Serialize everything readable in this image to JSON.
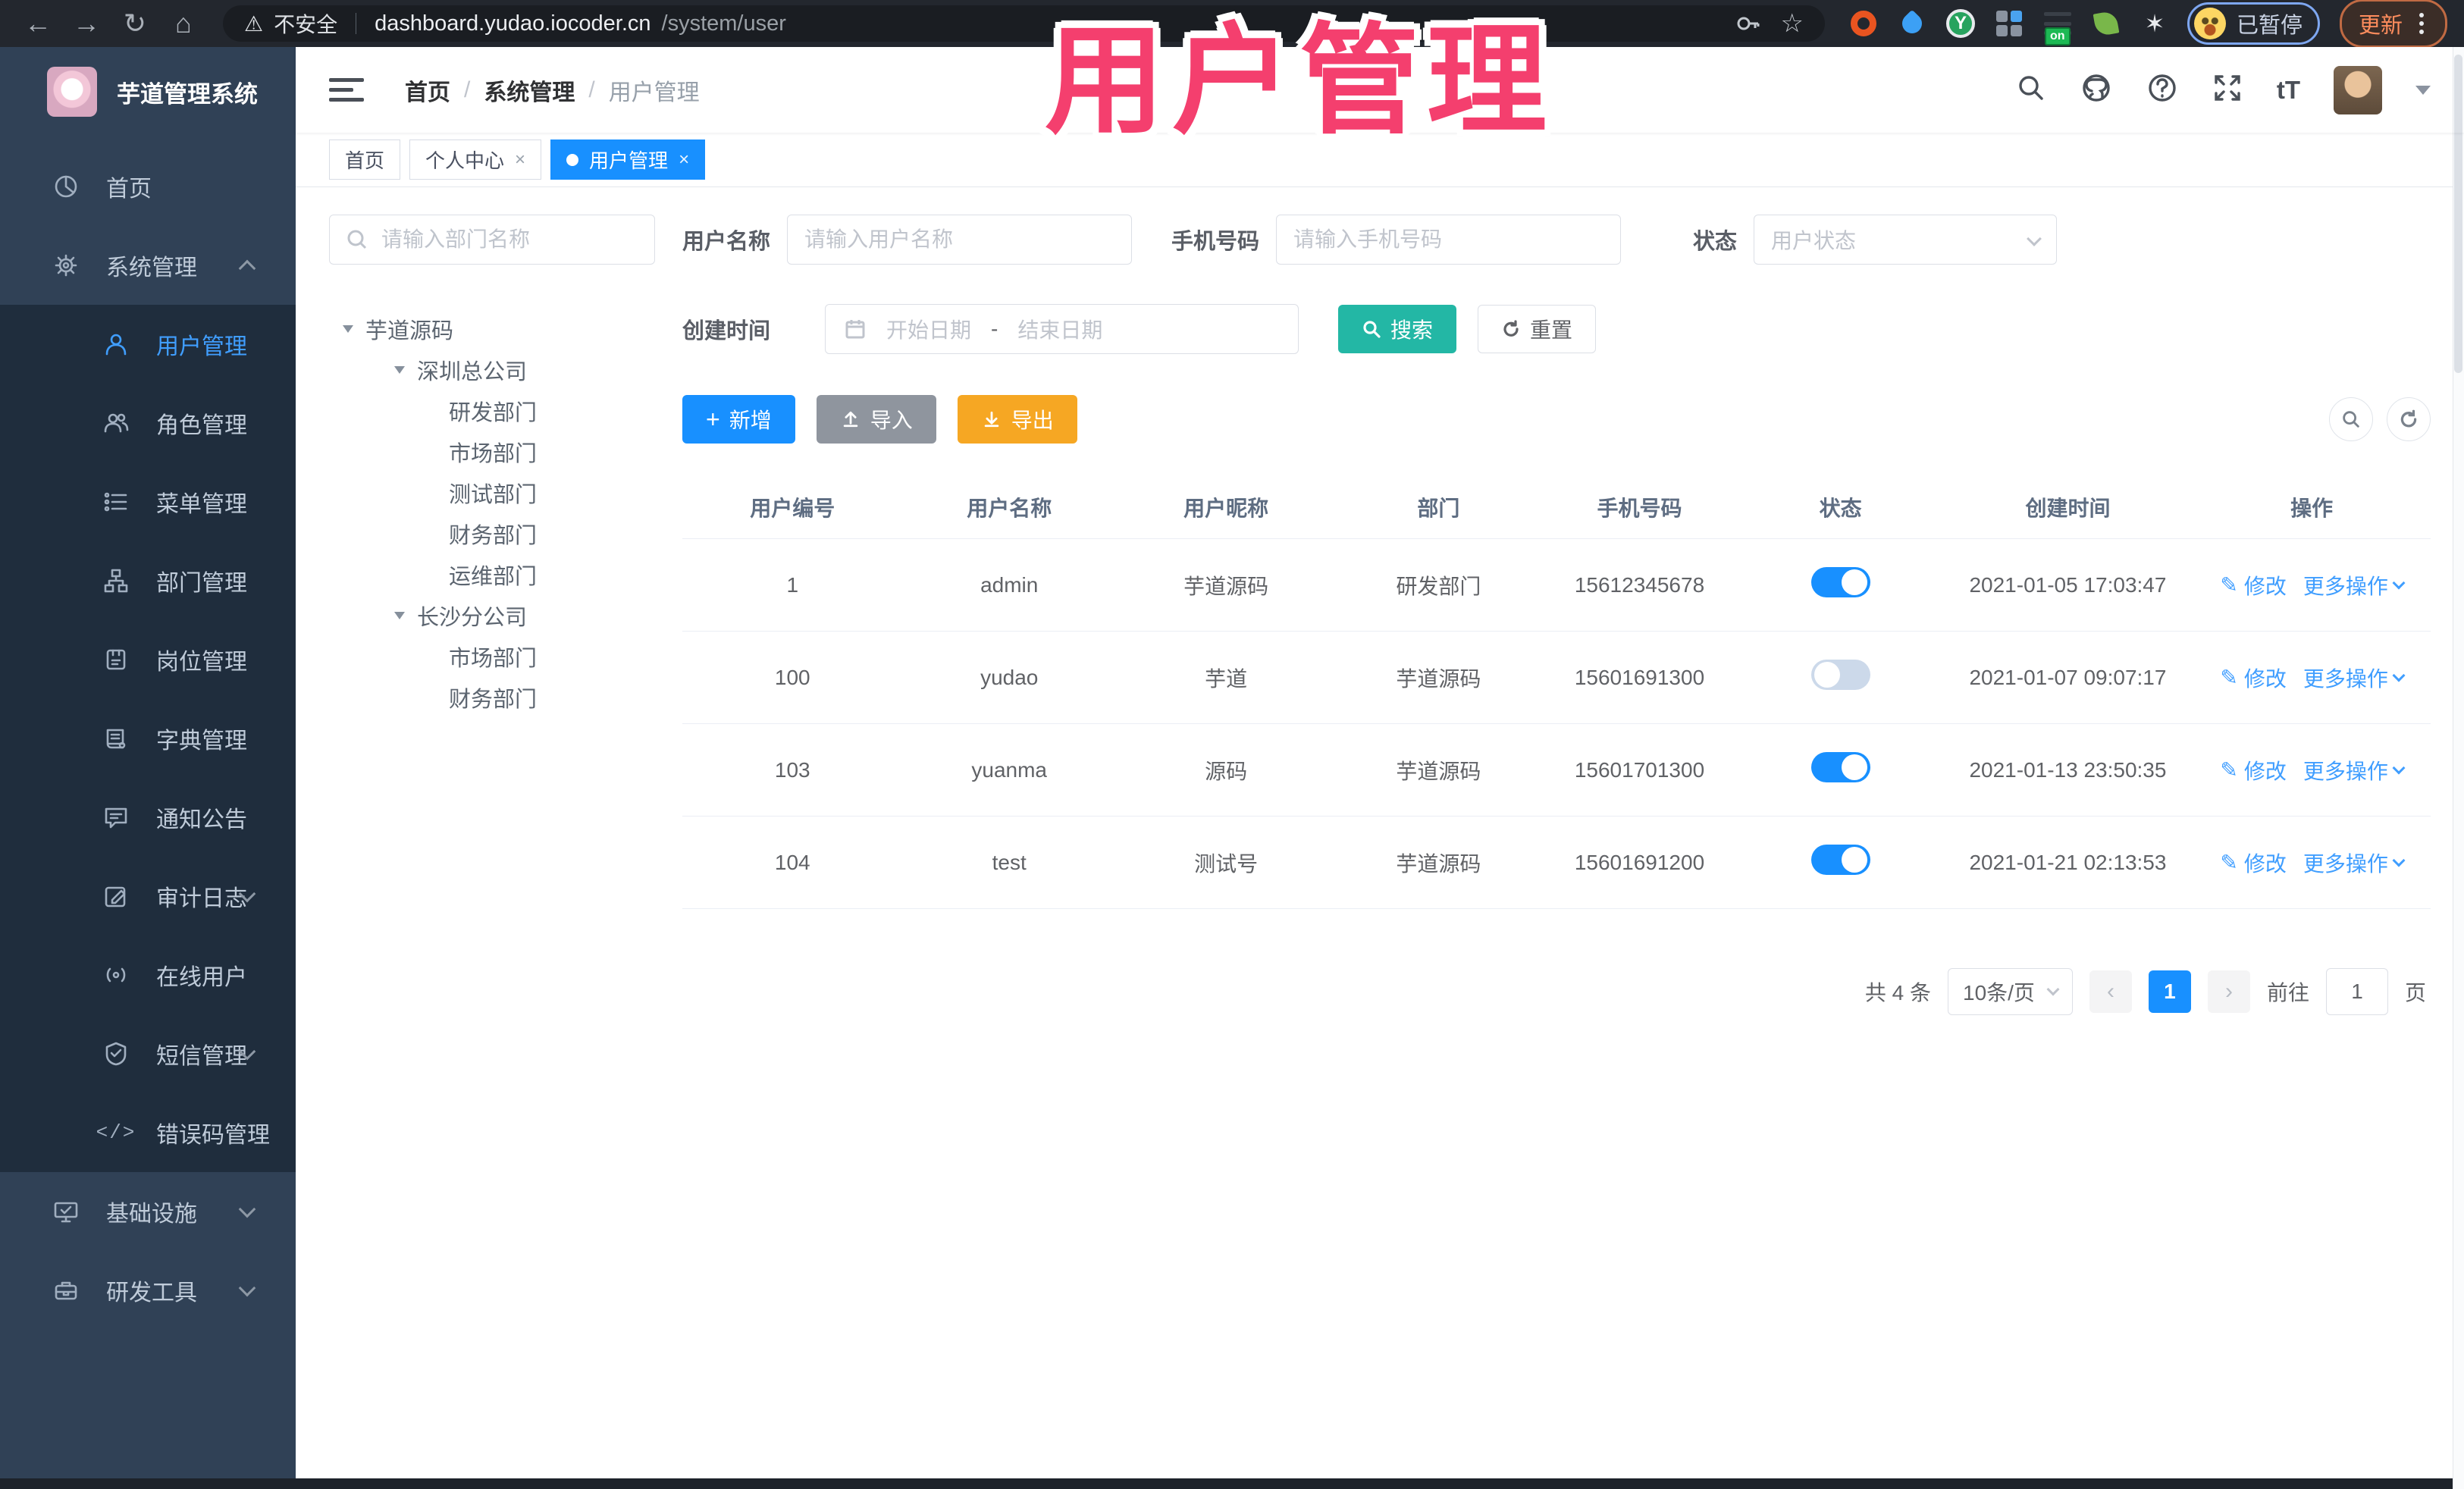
{
  "browser": {
    "security_label": "不安全",
    "url_host": "dashboard.yudao.iocoder.cn",
    "url_path": "/system/user",
    "extension_on_badge": "on",
    "profile_paused_badge": "已暂停",
    "update_button": "更新"
  },
  "annotation": {
    "title": "用户管理"
  },
  "sidebar": {
    "app_title": "芋道管理系统",
    "menu": [
      {
        "label": "首页"
      },
      {
        "label": "系统管理"
      },
      {
        "label": "用户管理"
      },
      {
        "label": "角色管理"
      },
      {
        "label": "菜单管理"
      },
      {
        "label": "部门管理"
      },
      {
        "label": "岗位管理"
      },
      {
        "label": "字典管理"
      },
      {
        "label": "通知公告"
      },
      {
        "label": "审计日志"
      },
      {
        "label": "在线用户"
      },
      {
        "label": "短信管理"
      },
      {
        "label": "错误码管理"
      },
      {
        "label": "基础设施"
      },
      {
        "label": "研发工具"
      }
    ]
  },
  "header": {
    "breadcrumb": [
      "首页",
      "系统管理",
      "用户管理"
    ],
    "font_size_icon_text": "tT"
  },
  "tabs": [
    {
      "label": "首页"
    },
    {
      "label": "个人中心"
    },
    {
      "label": "用户管理"
    }
  ],
  "dept": {
    "search_placeholder": "请输入部门名称",
    "nodes": [
      {
        "label": "芋道源码"
      },
      {
        "label": "深圳总公司"
      },
      {
        "label": "研发部门"
      },
      {
        "label": "市场部门"
      },
      {
        "label": "测试部门"
      },
      {
        "label": "财务部门"
      },
      {
        "label": "运维部门"
      },
      {
        "label": "长沙分公司"
      },
      {
        "label": "市场部门"
      },
      {
        "label": "财务部门"
      }
    ]
  },
  "filters": {
    "username_label": "用户名称",
    "username_placeholder": "请输入用户名称",
    "mobile_label": "手机号码",
    "mobile_placeholder": "请输入手机号码",
    "status_label": "状态",
    "status_placeholder": "用户状态",
    "create_time_label": "创建时间",
    "date_start_placeholder": "开始日期",
    "date_separator": "-",
    "date_end_placeholder": "结束日期",
    "search_label": "搜索",
    "reset_label": "重置"
  },
  "toolbar": {
    "add_label": "新增",
    "import_label": "导入",
    "export_label": "导出"
  },
  "table": {
    "columns": [
      "用户编号",
      "用户名称",
      "用户昵称",
      "部门",
      "手机号码",
      "状态",
      "创建时间",
      "操作"
    ],
    "edit_label": "修改",
    "more_label": "更多操作",
    "rows": [
      {
        "id": "1",
        "username": "admin",
        "nickname": "芋道源码",
        "dept": "研发部门",
        "mobile": "15612345678",
        "status": "on",
        "created": "2021-01-05 17:03:47"
      },
      {
        "id": "100",
        "username": "yudao",
        "nickname": "芋道",
        "dept": "芋道源码",
        "mobile": "15601691300",
        "status": "off",
        "created": "2021-01-07 09:07:17"
      },
      {
        "id": "103",
        "username": "yuanma",
        "nickname": "源码",
        "dept": "芋道源码",
        "mobile": "15601701300",
        "status": "on",
        "created": "2021-01-13 23:50:35"
      },
      {
        "id": "104",
        "username": "test",
        "nickname": "测试号",
        "dept": "芋道源码",
        "mobile": "15601691200",
        "status": "on",
        "created": "2021-01-21 02:13:53"
      }
    ]
  },
  "pagination": {
    "total_text": "共 4 条",
    "page_size": "10条/页",
    "current_page": "1",
    "goto_label": "前往",
    "goto_value": "1",
    "page_unit": "页"
  },
  "colors": {
    "primary": "#1890ff",
    "link": "#409eff",
    "search_button": "#23b7a5",
    "export_button": "#f6a723",
    "import_button": "#8f959e",
    "sidebar_bg": "#304156",
    "submenu_bg": "#1f2d3d",
    "annotation_pink": "#f43f6e"
  }
}
